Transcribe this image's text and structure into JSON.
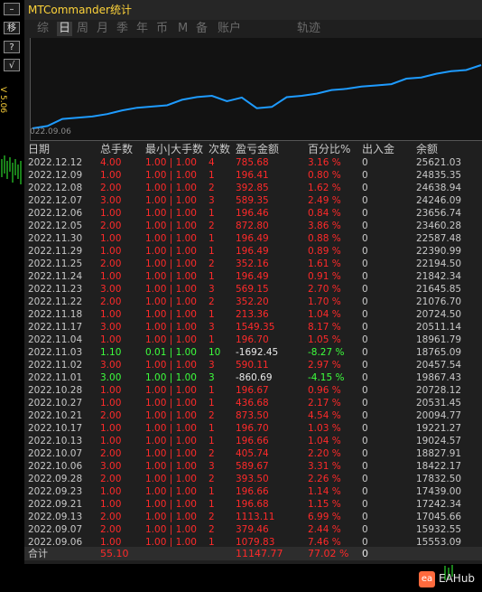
{
  "window": {
    "title": "MTCommander统计"
  },
  "side_buttons": {
    "minimize": "–",
    "move": "移",
    "help": "?",
    "check": "√"
  },
  "side_label": "V 5.06",
  "tabs": [
    {
      "label": "综",
      "active": false
    },
    {
      "label": "日",
      "active": true
    },
    {
      "label": "周",
      "active": false
    },
    {
      "label": "月",
      "active": false
    },
    {
      "label": "季",
      "active": false
    },
    {
      "label": "年",
      "active": false
    },
    {
      "label": "币",
      "active": false
    },
    {
      "label": "M",
      "active": false
    },
    {
      "label": "备",
      "active": false
    },
    {
      "label": "账户",
      "active": false
    },
    {
      "label": "轨迹",
      "active": false
    }
  ],
  "chart": {
    "date_label": "022.09.06",
    "line_color": "#1e9bff",
    "values": [
      15553.09,
      15932.55,
      17045.66,
      17242.34,
      17439.0,
      17832.5,
      18422.17,
      18827.91,
      19024.57,
      19221.27,
      20094.77,
      20531.45,
      20728.12,
      19867.43,
      20457.54,
      18765.09,
      18961.79,
      20511.14,
      20724.5,
      21076.7,
      21645.85,
      21842.34,
      22194.5,
      22390.99,
      22587.48,
      23460.28,
      23656.74,
      24246.09,
      24638.94,
      24835.35,
      25621.03
    ]
  },
  "table": {
    "headers": [
      "日期",
      "总手数",
      "最小|大手数",
      "次数",
      "盈亏金额",
      "百分比%",
      "出入金",
      "余额"
    ],
    "rows": [
      {
        "date": "2022.12.12",
        "lots": "4.00",
        "minmax": "1.00 | 1.00",
        "count": "4",
        "pnl": "785.68",
        "pct": "3.16 %",
        "flow": "0",
        "balance": "25621.03",
        "color": "red"
      },
      {
        "date": "2022.12.09",
        "lots": "1.00",
        "minmax": "1.00 | 1.00",
        "count": "1",
        "pnl": "196.41",
        "pct": "0.80 %",
        "flow": "0",
        "balance": "24835.35",
        "color": "red"
      },
      {
        "date": "2022.12.08",
        "lots": "2.00",
        "minmax": "1.00 | 1.00",
        "count": "2",
        "pnl": "392.85",
        "pct": "1.62 %",
        "flow": "0",
        "balance": "24638.94",
        "color": "red"
      },
      {
        "date": "2022.12.07",
        "lots": "3.00",
        "minmax": "1.00 | 1.00",
        "count": "3",
        "pnl": "589.35",
        "pct": "2.49 %",
        "flow": "0",
        "balance": "24246.09",
        "color": "red"
      },
      {
        "date": "2022.12.06",
        "lots": "1.00",
        "minmax": "1.00 | 1.00",
        "count": "1",
        "pnl": "196.46",
        "pct": "0.84 %",
        "flow": "0",
        "balance": "23656.74",
        "color": "red"
      },
      {
        "date": "2022.12.05",
        "lots": "2.00",
        "minmax": "1.00 | 1.00",
        "count": "2",
        "pnl": "872.80",
        "pct": "3.86 %",
        "flow": "0",
        "balance": "23460.28",
        "color": "red"
      },
      {
        "date": "2022.11.30",
        "lots": "1.00",
        "minmax": "1.00 | 1.00",
        "count": "1",
        "pnl": "196.49",
        "pct": "0.88 %",
        "flow": "0",
        "balance": "22587.48",
        "color": "red"
      },
      {
        "date": "2022.11.29",
        "lots": "1.00",
        "minmax": "1.00 | 1.00",
        "count": "1",
        "pnl": "196.49",
        "pct": "0.89 %",
        "flow": "0",
        "balance": "22390.99",
        "color": "red"
      },
      {
        "date": "2022.11.25",
        "lots": "2.00",
        "minmax": "1.00 | 1.00",
        "count": "2",
        "pnl": "352.16",
        "pct": "1.61 %",
        "flow": "0",
        "balance": "22194.50",
        "color": "red"
      },
      {
        "date": "2022.11.24",
        "lots": "1.00",
        "minmax": "1.00 | 1.00",
        "count": "1",
        "pnl": "196.49",
        "pct": "0.91 %",
        "flow": "0",
        "balance": "21842.34",
        "color": "red"
      },
      {
        "date": "2022.11.23",
        "lots": "3.00",
        "minmax": "1.00 | 1.00",
        "count": "3",
        "pnl": "569.15",
        "pct": "2.70 %",
        "flow": "0",
        "balance": "21645.85",
        "color": "red"
      },
      {
        "date": "2022.11.22",
        "lots": "2.00",
        "minmax": "1.00 | 1.00",
        "count": "2",
        "pnl": "352.20",
        "pct": "1.70 %",
        "flow": "0",
        "balance": "21076.70",
        "color": "red"
      },
      {
        "date": "2022.11.18",
        "lots": "1.00",
        "minmax": "1.00 | 1.00",
        "count": "1",
        "pnl": "213.36",
        "pct": "1.04 %",
        "flow": "0",
        "balance": "20724.50",
        "color": "red"
      },
      {
        "date": "2022.11.17",
        "lots": "3.00",
        "minmax": "1.00 | 1.00",
        "count": "3",
        "pnl": "1549.35",
        "pct": "8.17 %",
        "flow": "0",
        "balance": "20511.14",
        "color": "red"
      },
      {
        "date": "2022.11.04",
        "lots": "1.00",
        "minmax": "1.00 | 1.00",
        "count": "1",
        "pnl": "196.70",
        "pct": "1.05 %",
        "flow": "0",
        "balance": "18961.79",
        "color": "red"
      },
      {
        "date": "2022.11.03",
        "lots": "1.10",
        "minmax": "0.01 | 1.00",
        "count": "10",
        "pnl": "-1692.45",
        "pct": "-8.27 %",
        "flow": "0",
        "balance": "18765.09",
        "color": "green"
      },
      {
        "date": "2022.11.02",
        "lots": "3.00",
        "minmax": "1.00 | 1.00",
        "count": "3",
        "pnl": "590.11",
        "pct": "2.97 %",
        "flow": "0",
        "balance": "20457.54",
        "color": "red"
      },
      {
        "date": "2022.11.01",
        "lots": "3.00",
        "minmax": "1.00 | 1.00",
        "count": "3",
        "pnl": "-860.69",
        "pct": "-4.15 %",
        "flow": "0",
        "balance": "19867.43",
        "color": "green"
      },
      {
        "date": "2022.10.28",
        "lots": "1.00",
        "minmax": "1.00 | 1.00",
        "count": "1",
        "pnl": "196.67",
        "pct": "0.96 %",
        "flow": "0",
        "balance": "20728.12",
        "color": "red"
      },
      {
        "date": "2022.10.27",
        "lots": "1.00",
        "minmax": "1.00 | 1.00",
        "count": "1",
        "pnl": "436.68",
        "pct": "2.17 %",
        "flow": "0",
        "balance": "20531.45",
        "color": "red"
      },
      {
        "date": "2022.10.21",
        "lots": "2.00",
        "minmax": "1.00 | 1.00",
        "count": "2",
        "pnl": "873.50",
        "pct": "4.54 %",
        "flow": "0",
        "balance": "20094.77",
        "color": "red"
      },
      {
        "date": "2022.10.17",
        "lots": "1.00",
        "minmax": "1.00 | 1.00",
        "count": "1",
        "pnl": "196.70",
        "pct": "1.03 %",
        "flow": "0",
        "balance": "19221.27",
        "color": "red"
      },
      {
        "date": "2022.10.13",
        "lots": "1.00",
        "minmax": "1.00 | 1.00",
        "count": "1",
        "pnl": "196.66",
        "pct": "1.04 %",
        "flow": "0",
        "balance": "19024.57",
        "color": "red"
      },
      {
        "date": "2022.10.07",
        "lots": "2.00",
        "minmax": "1.00 | 1.00",
        "count": "2",
        "pnl": "405.74",
        "pct": "2.20 %",
        "flow": "0",
        "balance": "18827.91",
        "color": "red"
      },
      {
        "date": "2022.10.06",
        "lots": "3.00",
        "minmax": "1.00 | 1.00",
        "count": "3",
        "pnl": "589.67",
        "pct": "3.31 %",
        "flow": "0",
        "balance": "18422.17",
        "color": "red"
      },
      {
        "date": "2022.09.28",
        "lots": "2.00",
        "minmax": "1.00 | 1.00",
        "count": "2",
        "pnl": "393.50",
        "pct": "2.26 %",
        "flow": "0",
        "balance": "17832.50",
        "color": "red"
      },
      {
        "date": "2022.09.23",
        "lots": "1.00",
        "minmax": "1.00 | 1.00",
        "count": "1",
        "pnl": "196.66",
        "pct": "1.14 %",
        "flow": "0",
        "balance": "17439.00",
        "color": "red"
      },
      {
        "date": "2022.09.21",
        "lots": "1.00",
        "minmax": "1.00 | 1.00",
        "count": "1",
        "pnl": "196.68",
        "pct": "1.15 %",
        "flow": "0",
        "balance": "17242.34",
        "color": "red"
      },
      {
        "date": "2022.09.13",
        "lots": "2.00",
        "minmax": "1.00 | 1.00",
        "count": "2",
        "pnl": "1113.11",
        "pct": "6.99 %",
        "flow": "0",
        "balance": "17045.66",
        "color": "red"
      },
      {
        "date": "2022.09.07",
        "lots": "2.00",
        "minmax": "1.00 | 1.00",
        "count": "2",
        "pnl": "379.46",
        "pct": "2.44 %",
        "flow": "0",
        "balance": "15932.55",
        "color": "red"
      },
      {
        "date": "2022.09.06",
        "lots": "1.00",
        "minmax": "1.00 | 1.00",
        "count": "1",
        "pnl": "1079.83",
        "pct": "7.46 %",
        "flow": "0",
        "balance": "15553.09",
        "color": "red"
      }
    ],
    "total": {
      "label": "合计",
      "lots": "55.10",
      "pnl": "11147.77",
      "pct": "77.02 %",
      "flow": "0"
    }
  },
  "logo": {
    "text": "EAHub",
    "mark": "ea"
  },
  "colors": {
    "positive": "#ff2a2a",
    "negative": "#3dff3d",
    "title": "#ffd43a",
    "curve": "#1e9bff"
  }
}
